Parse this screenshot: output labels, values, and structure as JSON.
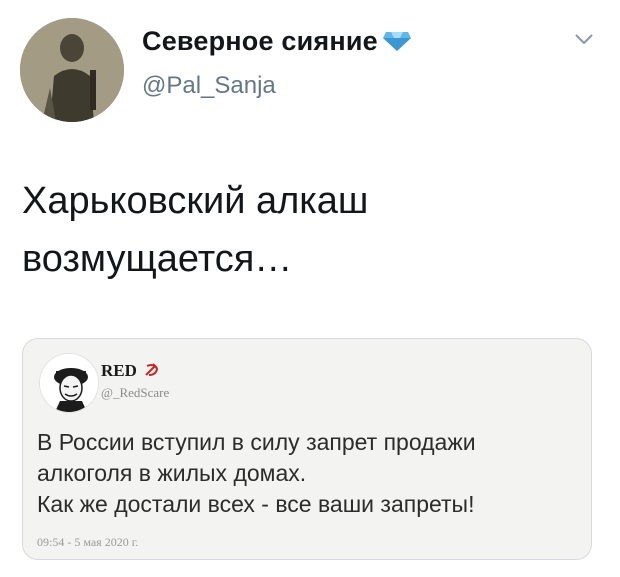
{
  "author": {
    "display_name": "Северное сияние",
    "handle": "@Pal_Sanja",
    "badge_icon": "diamond-icon",
    "avatar": "avatar-photo"
  },
  "tweet": {
    "lines": [
      "Харьковский алкаш",
      "возмущается…"
    ]
  },
  "quoted_tweet": {
    "display_name": "RED",
    "name_icon": "hammer-sickle-icon",
    "handle": "@_RedScare",
    "lines": [
      "В России вступил в силу запрет продажи",
      "алкоголя в жилых домах.",
      "Как же достали всех - все ваши запреты!"
    ],
    "timestamp": "09:54 - 5 мая 2020 г."
  },
  "colors": {
    "text": "#14171a",
    "secondary": "#657786",
    "card_bg": "#f3f3f1",
    "diamond": "#5fb6e8"
  }
}
